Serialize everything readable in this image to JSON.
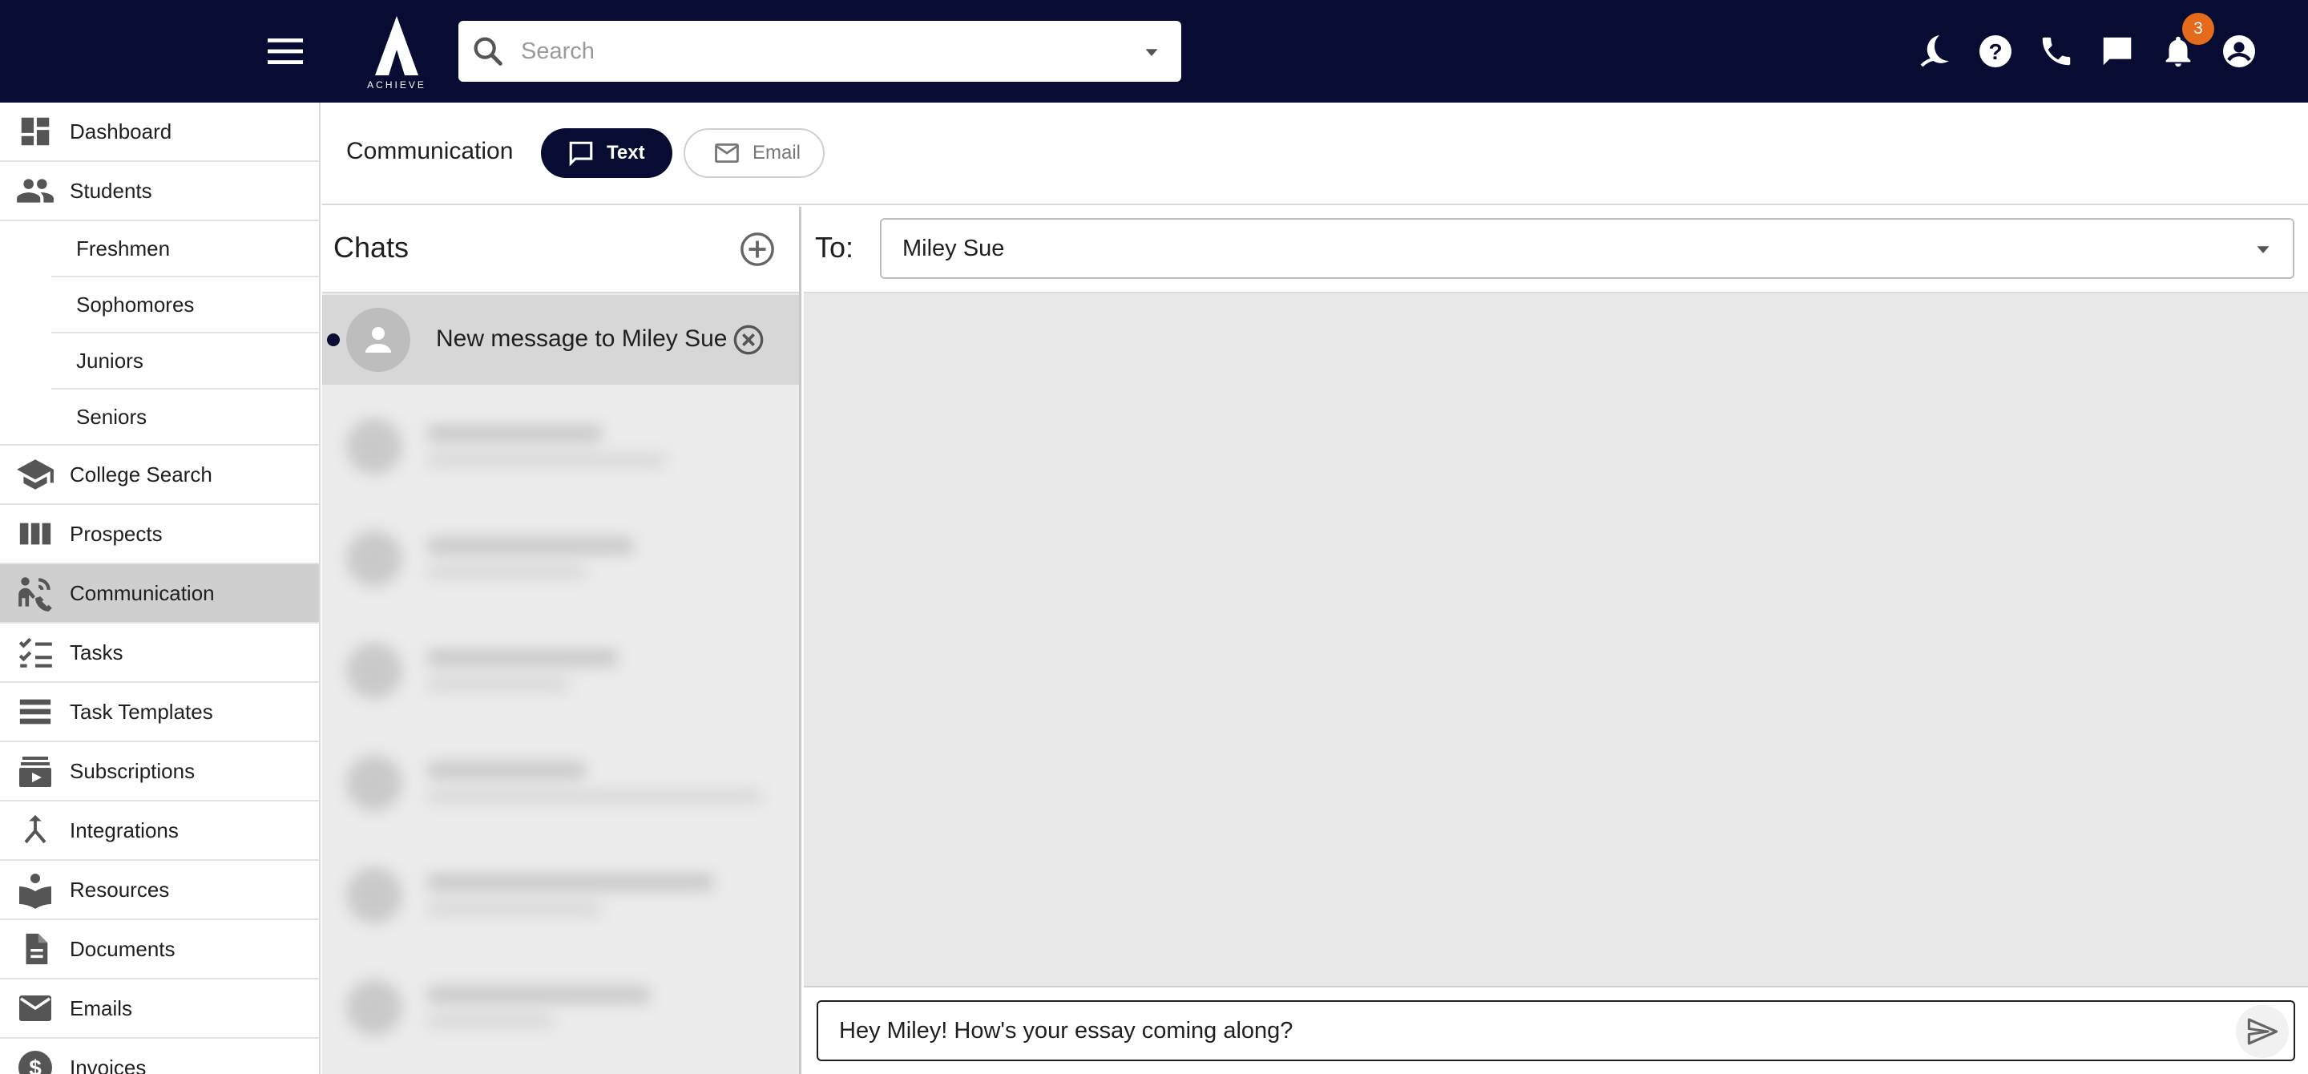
{
  "topbar": {
    "logo_text": "ACHIEVE",
    "search_placeholder": "Search",
    "notification_count": "3",
    "icons": [
      "menu-icon",
      "search-icon",
      "dropdown-arrow-icon",
      "dark-mode-icon",
      "help-icon",
      "phone-icon",
      "chat-icon",
      "bell-icon",
      "account-icon"
    ]
  },
  "sidebar": {
    "items": [
      {
        "label": "Dashboard",
        "icon": "dashboard-icon"
      },
      {
        "label": "Students",
        "icon": "people-icon"
      },
      {
        "label": "College Search",
        "icon": "school-icon"
      },
      {
        "label": "Prospects",
        "icon": "columns-icon"
      },
      {
        "label": "Communication",
        "icon": "communication-icon",
        "active": true
      },
      {
        "label": "Tasks",
        "icon": "checklist-icon"
      },
      {
        "label": "Task Templates",
        "icon": "list-icon"
      },
      {
        "label": "Subscriptions",
        "icon": "subscriptions-icon"
      },
      {
        "label": "Integrations",
        "icon": "merge-icon"
      },
      {
        "label": "Resources",
        "icon": "book-icon"
      },
      {
        "label": "Documents",
        "icon": "document-icon"
      },
      {
        "label": "Emails",
        "icon": "mail-icon"
      },
      {
        "label": "Invoices",
        "icon": "dollar-icon"
      }
    ],
    "students_sub": [
      {
        "label": "Freshmen"
      },
      {
        "label": "Sophomores"
      },
      {
        "label": "Juniors"
      },
      {
        "label": "Seniors"
      }
    ]
  },
  "header": {
    "title": "Communication",
    "tabs": [
      {
        "label": "Text",
        "active": true
      },
      {
        "label": "Email",
        "active": false
      }
    ]
  },
  "chats": {
    "title": "Chats",
    "active_chat": {
      "name": "New message to Miley Sue"
    }
  },
  "conversation": {
    "to_label": "To:",
    "recipient": "Miley Sue",
    "message_draft": "Hey Miley! How's your essay coming along?"
  },
  "colors": {
    "brand_navy": "#080c33",
    "badge_orange": "#e56a1b",
    "active_nav": "#cfcfcf"
  }
}
